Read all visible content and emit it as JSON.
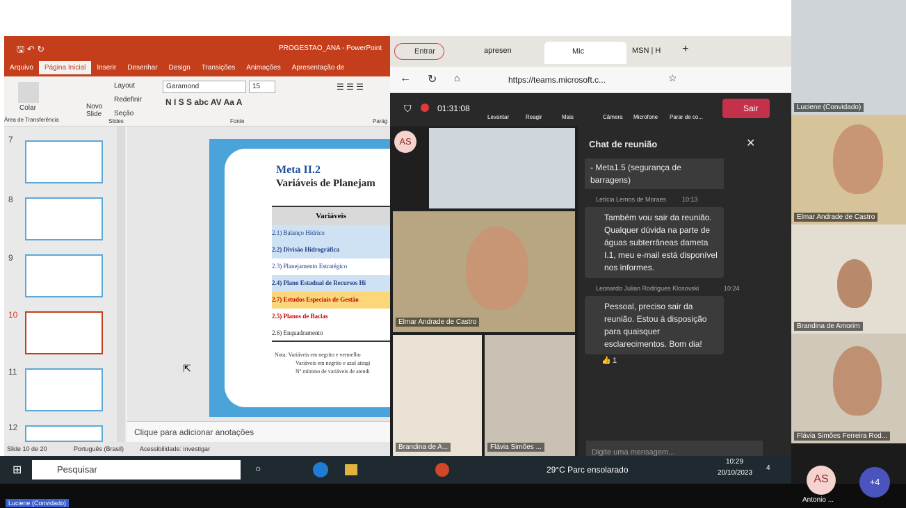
{
  "powerpoint": {
    "title": "PROGESTAO_ANA - PowerPoint",
    "tabs": [
      "Arquivo",
      "Página Inicial",
      "Inserir",
      "Desenhar",
      "Design",
      "Transições",
      "Animações",
      "Apresentação de"
    ],
    "ribbon": {
      "paste": "Colar",
      "clipboard": "Área de Transferência",
      "new_slide": "Novo Slide",
      "layout": "Layout",
      "reset": "Redefinir",
      "section": "Seção",
      "slides_group": "Slides",
      "font_name": "Garamond",
      "font_size": "15",
      "font_group": "Fonte",
      "paragraph_group": "Parág"
    },
    "thumb_numbers": [
      "7",
      "8",
      "9",
      "10",
      "11",
      "12"
    ],
    "slide": {
      "heading": "Meta II.2",
      "subheading": "Variáveis de Planejam",
      "table_header": "Variáveis",
      "rows": [
        "2.1) Balanço Hídrico",
        "2.2) Divisão Hidrográfica",
        "2.3) Planejamento Estratégico",
        "2.4) Plano Estadual de Recursos Hí",
        "2.7) Estudos Especiais de Gestão",
        "2.5) Planos de Bacias",
        "2.6) Enquadramento"
      ],
      "note1": "Nota: Variáveis em negrito e vermelho",
      "note2": "Variáveis em negrito e azul atingi",
      "note3": "Nº mínimo de variáveis de atendi"
    },
    "notes_placeholder": "Clique para adicionar anotações",
    "status": {
      "slide": "Slide 10 de 20",
      "lang": "Português (Brasil)",
      "a11y": "Acessibilidade: investigar"
    }
  },
  "browser": {
    "profile": "Entrar",
    "tabs": [
      "apresen",
      "Mic",
      "MSN | H"
    ],
    "url": "https://teams.microsoft.c..."
  },
  "teams": {
    "timer": "01:31:08",
    "buttons": [
      "Levantar",
      "Reagir",
      "Mais",
      "Câmera",
      "Microfone",
      "Parar de co..."
    ],
    "leave": "Sair",
    "avatar": "AS",
    "video_names": [
      "Elmar Andrade de Castro",
      "Brandina de A...",
      "Flávia Simões ..."
    ],
    "chat": {
      "title": "Chat de reunião",
      "top_msg": "- Meta1.5 (segurança de barragens)",
      "messages": [
        {
          "author": "Letícia Lemos de Moraes",
          "time": "10:13",
          "text": "Também vou sair da reunião. Qualquer dúvida na parte de águas subterrâneas dameta I.1, meu e-mail está disponível nos informes."
        },
        {
          "author": "Leonardo Julian Rodrigues Klosovski",
          "time": "10:24",
          "text": "Pessoal, preciso sair da reunião. Estou à disposição para quaisquer esclarecimentos. Bom dia!"
        }
      ],
      "reaction": "1",
      "placeholder": "Digite uma mensagem..."
    }
  },
  "taskbar": {
    "search": "Pesquisar",
    "weather": "29°C  Parc ensolarado",
    "time": "10:29",
    "date": "20/10/2023",
    "notif": "4"
  },
  "participants": [
    {
      "name": "Luciene (Convidado)"
    },
    {
      "name": "Elmar Andrade de Castro"
    },
    {
      "name": "Brandina de Amorim"
    },
    {
      "name": "Flávia Simões Ferreira Rod..."
    }
  ],
  "bottom": {
    "label": "Luciene (Convidado)",
    "avatar": "AS",
    "avatar_name": "Antonio ...",
    "more": "+4"
  }
}
